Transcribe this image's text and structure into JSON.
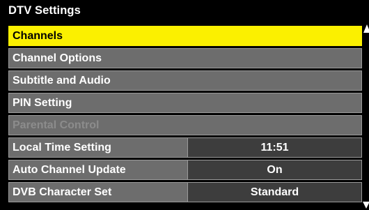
{
  "menu": {
    "title": "DTV Settings",
    "items": [
      {
        "label": "Channels",
        "state": "selected"
      },
      {
        "label": "Channel Options",
        "state": "normal"
      },
      {
        "label": "Subtitle and Audio",
        "state": "normal"
      },
      {
        "label": "PIN Setting",
        "state": "normal"
      },
      {
        "label": "Parental Control",
        "state": "disabled"
      },
      {
        "label": "Local Time Setting",
        "value": "11:51"
      },
      {
        "label": "Auto Channel Update",
        "value": "On"
      },
      {
        "label": "DVB Character Set",
        "value": "Standard"
      }
    ]
  },
  "scrollbar": {
    "up_icon": "triangle-up-icon",
    "down_icon": "triangle-down-icon"
  },
  "colors": {
    "highlight": "#fbf000",
    "row_bg": "#6d6d6d",
    "value_bg": "#3d3d3d",
    "disabled_text": "#8c8c8c"
  }
}
